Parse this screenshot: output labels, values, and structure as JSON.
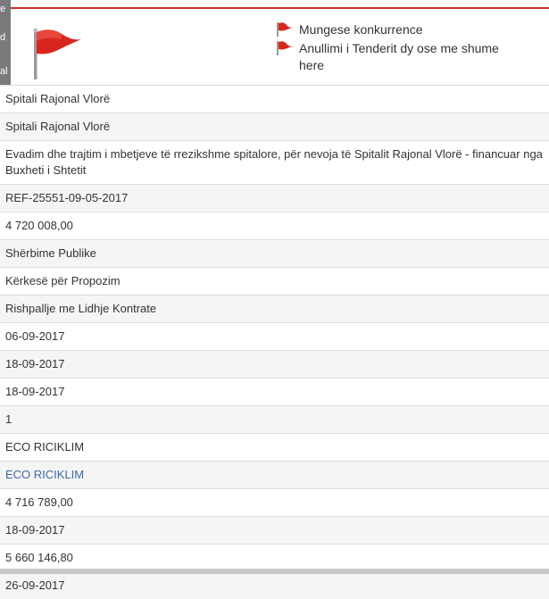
{
  "left_strip": {
    "fragments": [
      "e",
      "d",
      "al"
    ]
  },
  "flags": {
    "items": [
      {
        "label": "Mungese konkurrence"
      },
      {
        "label": "Anullimi i Tenderit dy ose me shume here"
      }
    ]
  },
  "rows": [
    "Spitali Rajonal Vlorë",
    "Spitali Rajonal Vlorë",
    "Evadim dhe trajtim i mbetjeve të rrezikshme spitalore, për nevoja të Spitalit Rajonal Vlorë - financuar nga Buxheti i Shtetit",
    "REF-25551-09-05-2017",
    "4 720 008,00",
    "Shërbime Publike",
    "Kërkesë për Propozim",
    "Rishpallje me Lidhje Kontrate",
    "06-09-2017",
    "18-09-2017",
    "18-09-2017",
    "1",
    "ECO RICIKLIM",
    "ECO RICIKLIM",
    "4 716 789,00",
    "18-09-2017",
    "5 660 146,80",
    "26-09-2017"
  ],
  "colors": {
    "flag_red": "#d9261c",
    "link_blue": "#3b6aa8",
    "top_border": "#c9302c"
  }
}
